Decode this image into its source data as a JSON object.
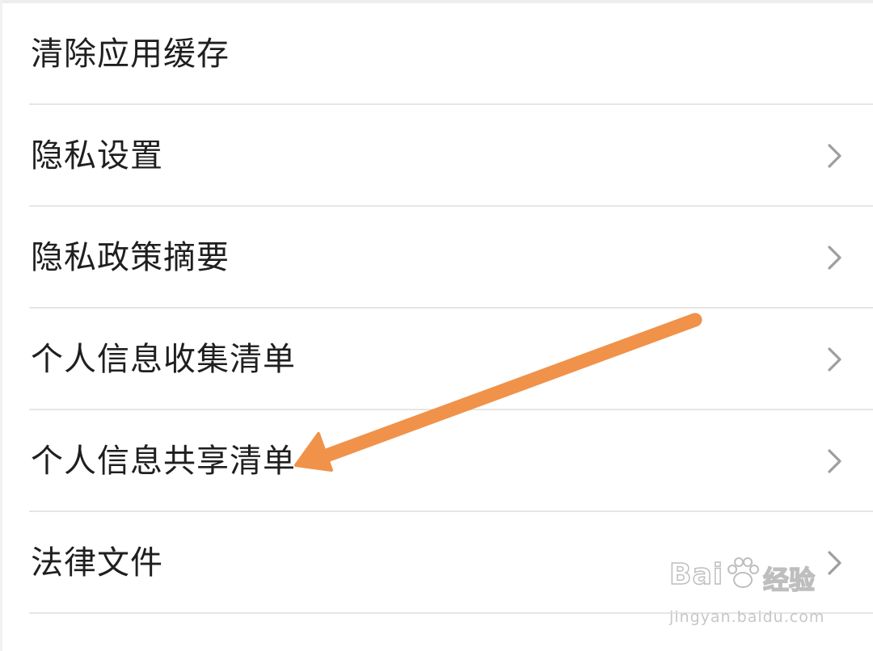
{
  "menu": {
    "items": [
      {
        "label": "清除应用缓存",
        "has_chevron": false
      },
      {
        "label": "隐私设置",
        "has_chevron": true
      },
      {
        "label": "隐私政策摘要",
        "has_chevron": true
      },
      {
        "label": "个人信息收集清单",
        "has_chevron": true
      },
      {
        "label": "个人信息共享清单",
        "has_chevron": true
      },
      {
        "label": "法律文件",
        "has_chevron": true
      }
    ],
    "chevron_icon": "chevron-right-icon"
  },
  "annotation": {
    "icon": "orange-arrow",
    "color": "#f0924a",
    "points_to_item": "个人信息共享清单"
  },
  "watermark": {
    "brand_text": "Bai",
    "brand_text_2": "经验",
    "url": "jingyan.baidu.com",
    "icon": "paw-icon"
  }
}
